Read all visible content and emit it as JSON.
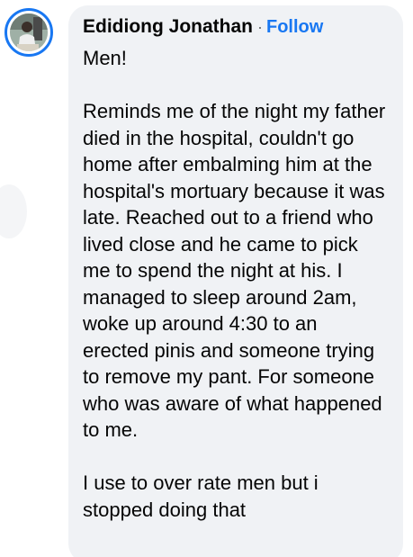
{
  "comment": {
    "author": "Edidiong Jonathan",
    "separator": "·",
    "follow_label": "Follow",
    "paragraphs": [
      "Men!",
      "Reminds me of the night my father died in the hospital, couldn't go home after embalming him at the hospital's mortuary because it was late. Reached out to a friend who lived close and he came to pick me to spend the night at his. I managed to sleep around 2am, woke up around 4:30 to an erected pinis and someone trying to remove my pant. For someone who was aware of what happened to me.",
      "I use to over rate men but i stopped doing that"
    ]
  },
  "colors": {
    "bubble": "#f0f2f5",
    "link": "#1877f2",
    "text": "#050505"
  }
}
